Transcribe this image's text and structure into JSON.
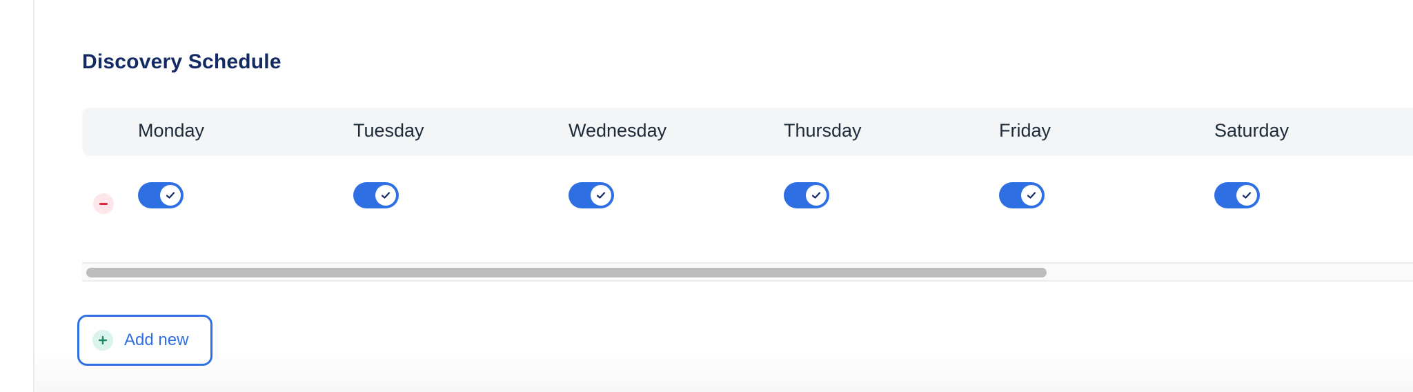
{
  "section": {
    "title": "Discovery Schedule"
  },
  "schedule": {
    "days": [
      {
        "label": "Monday",
        "enabled": true
      },
      {
        "label": "Tuesday",
        "enabled": true
      },
      {
        "label": "Wednesday",
        "enabled": true
      },
      {
        "label": "Thursday",
        "enabled": true
      },
      {
        "label": "Friday",
        "enabled": true
      },
      {
        "label": "Saturday",
        "enabled": true
      }
    ],
    "remove_icon": "minus-icon",
    "toggle_icon": "check-icon"
  },
  "scrollbar": {
    "visible_fraction": 0.72
  },
  "add_button": {
    "label": "Add new",
    "icon": "plus-icon"
  },
  "colors": {
    "accent": "#2f6fe4",
    "title": "#142a63",
    "remove": "#e2283f",
    "remove_bg": "#fde7ea",
    "add_icon": "#1f8a62",
    "header_bg": "#f3f5f7"
  }
}
